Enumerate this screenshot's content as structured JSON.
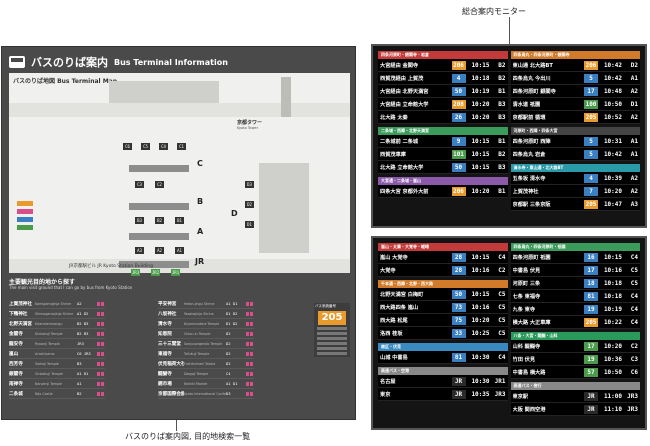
{
  "captions": {
    "monitor": "総合案内モニター",
    "board": "バスのりば案内図, 目的地検索一覧"
  },
  "board": {
    "title_jp": "バスのりば案内",
    "title_en": "Bus Terminal Information",
    "map_label": "バスのりば地図 Bus Terminal Map",
    "tower_jp": "京都タワー",
    "tower_en": "Kyoto Tower",
    "station_jp": "JR京都駅ビル",
    "station_en": "JR Kyoto Station Building",
    "zones": [
      "C",
      "B",
      "A",
      "D",
      "JR"
    ],
    "section_title": "主要観光目的地から探す",
    "section_sub": "The main visit ground that I can go by bus from Kyoto Station",
    "route_key_caption": "バス系統番号",
    "route_badge": "205"
  },
  "destinations": [
    [
      {
        "jp": "上賀茂神社",
        "en": "Kamigamojinja Shrine",
        "bays": "A2"
      },
      {
        "jp": "下鴨神社",
        "en": "Shimogamojinja Shrine",
        "bays": "A1 D2"
      },
      {
        "jp": "北野天満宮",
        "en": "Kitanotenmangu",
        "bays": "B2 B3"
      },
      {
        "jp": "金閣寺",
        "en": "Kinkakuji Temple",
        "bays": "B2 B3"
      },
      {
        "jp": "龍安寺",
        "en": "Ryoanji Temple",
        "bays": "JR3"
      },
      {
        "jp": "嵐山",
        "en": "Arashiyama",
        "bays": "C6 JR3"
      },
      {
        "jp": "西芳寺",
        "en": "Saihoji Temple",
        "bays": "B3"
      },
      {
        "jp": "銀閣寺",
        "en": "Ginkakuji Temple",
        "bays": "A1 D1"
      },
      {
        "jp": "南禅寺",
        "en": "Nanzenji Temple",
        "bays": "A1"
      },
      {
        "jp": "二条城",
        "en": "Nijo Castle",
        "bays": "B2"
      }
    ],
    [
      {
        "jp": "平安神宮",
        "en": "Heian-jingu Shrine",
        "bays": "A1 D1"
      },
      {
        "jp": "八坂神社",
        "en": "Yasakajinja Shrine",
        "bays": "D1 D2"
      },
      {
        "jp": "清水寺",
        "en": "Kiyomizudera Temple",
        "bays": "D1 D2"
      },
      {
        "jp": "知恩院",
        "en": "Chion-in Temple",
        "bays": "D2"
      },
      {
        "jp": "三十三間堂",
        "en": "Sanjusangendo Temple",
        "bays": "D2"
      },
      {
        "jp": "東福寺",
        "en": "Tofukuji Temple",
        "bays": "D2"
      },
      {
        "jp": "伏見稲荷大社",
        "en": "Fushimiinari Taisha",
        "bays": "D2"
      },
      {
        "jp": "醍醐寺",
        "en": "Daigoji Temple",
        "bays": "C4"
      },
      {
        "jp": "錦市場",
        "en": "Nishiki Market",
        "bays": "A1 D1"
      },
      {
        "jp": "京都国際会館",
        "en": "Kyoto International Conference",
        "bays": "D3"
      }
    ]
  ],
  "monitor1": {
    "left": [
      {
        "head": "四条河原町・銀閣寺・岩倉",
        "color": "#c23a3a",
        "rows": [
          {
            "dest": "大宮経由 金閣寺",
            "num": "206",
            "numColor": "#e89a2c",
            "time": "10:15",
            "bay": "B2"
          },
          {
            "dest": "西賀茂経由 上賀茂",
            "num": "4",
            "numColor": "#3a7fc2",
            "time": "10:18",
            "bay": "B2"
          },
          {
            "dest": "大宮経由 北野天満宮",
            "num": "50",
            "numColor": "#3a7fc2",
            "time": "10:19",
            "bay": "B1"
          },
          {
            "dest": "大宮経由 立命館大学",
            "num": "208",
            "numColor": "#e89a2c",
            "time": "10:20",
            "bay": "B3"
          },
          {
            "dest": "北大路 太秦",
            "num": "26",
            "numColor": "#3a7fc2",
            "time": "10:20",
            "bay": "B3"
          }
        ]
      },
      {
        "head": "二条城・西陣・北野天満宮",
        "color": "#3a9b5a",
        "rows": [
          {
            "dest": "二条城前 二条城",
            "num": "9",
            "numColor": "#3a7fc2",
            "time": "10:15",
            "bay": "B1"
          },
          {
            "dest": "西賀茂車庫",
            "num": "101",
            "numColor": "#4a9b4a",
            "time": "10:15",
            "bay": "B2"
          },
          {
            "dest": "北大路 立命館大学",
            "num": "50",
            "numColor": "#3a7fc2",
            "time": "10:15",
            "bay": "B3"
          }
        ]
      },
      {
        "head": "大宮通・二条城・嵐山",
        "color": "#8a5aa8",
        "rows": [
          {
            "dest": "四条大宮 京都外大前",
            "num": "206",
            "numColor": "#e89a2c",
            "time": "10:20",
            "bay": "B1"
          }
        ]
      }
    ],
    "right": [
      {
        "head": "四条烏丸・四条河原町・銀閣寺",
        "color": "#d07a2a",
        "rows": [
          {
            "dest": "東山通 北大路BT",
            "num": "206",
            "numColor": "#e89a2c",
            "time": "10:42",
            "bay": "D2"
          },
          {
            "dest": "四条烏丸 今出川",
            "num": "5",
            "numColor": "#3a7fc2",
            "time": "10:42",
            "bay": "A1"
          },
          {
            "dest": "四条河原町 銀閣寺",
            "num": "17",
            "numColor": "#3a7fc2",
            "time": "10:48",
            "bay": "A2"
          },
          {
            "dest": "清水道 祇園",
            "num": "100",
            "numColor": "#4a9b4a",
            "time": "10:50",
            "bay": "D1"
          },
          {
            "dest": "京都駅前 循環",
            "num": "205",
            "numColor": "#e89a2c",
            "time": "10:52",
            "bay": "A2"
          }
        ]
      },
      {
        "head": "河原町・西陣・四条大宮",
        "color": "#444444",
        "rows": [
          {
            "dest": "四条河原町 西陣",
            "num": "5",
            "numColor": "#3a7fc2",
            "time": "10:31",
            "bay": "A1"
          },
          {
            "dest": "四条烏丸 岩倉",
            "num": "5",
            "numColor": "#3a7fc2",
            "time": "10:42",
            "bay": "A1"
          }
        ]
      },
      {
        "head": "清水寺・東山通・北大路BT",
        "color": "#2a9aa8",
        "rows": [
          {
            "dest": "五条坂 清水寺",
            "num": "4",
            "numColor": "#3a7fc2",
            "time": "10:39",
            "bay": "A2"
          },
          {
            "dest": "上賀茂神社",
            "num": "7",
            "numColor": "#3a7fc2",
            "time": "10:20",
            "bay": "A2"
          },
          {
            "dest": "京都駅 三条京阪",
            "num": "205",
            "numColor": "#e89a2c",
            "time": "10:47",
            "bay": "A3"
          }
        ]
      }
    ]
  },
  "monitor2": {
    "left": [
      {
        "head": "嵐山・太秦・大覚寺・嵯峨",
        "color": "#c23a3a",
        "rows": [
          {
            "dest": "嵐山 大覚寺",
            "num": "28",
            "numColor": "#3a7fc2",
            "time": "10:15",
            "bay": "C4"
          },
          {
            "dest": "大覚寺",
            "num": "28",
            "numColor": "#3a7fc2",
            "time": "10:16",
            "bay": "C2"
          }
        ]
      },
      {
        "head": "千本通・西陣・北野・西大路",
        "color": "#d07a2a",
        "rows": [
          {
            "dest": "北野天満宮 白梅町",
            "num": "50",
            "numColor": "#3a7fc2",
            "time": "10:15",
            "bay": "C5"
          },
          {
            "dest": "西大路四条 嵐山",
            "num": "73",
            "numColor": "#3a7fc2",
            "time": "10:16",
            "bay": "C5"
          },
          {
            "dest": "西大路 松尾",
            "num": "75",
            "numColor": "#3a7fc2",
            "time": "10:20",
            "bay": "C5"
          },
          {
            "dest": "洛西 桂坂",
            "num": "33",
            "numColor": "#3a7fc2",
            "time": "10:25",
            "bay": "C5"
          }
        ]
      },
      {
        "head": "南区・伏見",
        "color": "#3a8ac2",
        "rows": [
          {
            "dest": "山城 中書島",
            "num": "81",
            "numColor": "#3a7fc2",
            "time": "10:30",
            "bay": "C4"
          }
        ]
      },
      {
        "head": "高速バス・空港",
        "color": "#888888",
        "rows": [
          {
            "dest": "名古屋",
            "num": "JR",
            "numColor": "#2a2a2a",
            "time": "10:30",
            "bay": "JR1"
          },
          {
            "dest": "東京",
            "num": "JR",
            "numColor": "#2a2a2a",
            "time": "10:35",
            "bay": "JR3"
          }
        ]
      }
    ],
    "right": [
      {
        "head": "四条烏丸・四条河原町・祇園",
        "color": "#3a9b5a",
        "rows": [
          {
            "dest": "四条河原町 祇園",
            "num": "16",
            "numColor": "#3a7fc2",
            "time": "10:15",
            "bay": "C4"
          },
          {
            "dest": "中書島 伏見",
            "num": "17",
            "numColor": "#3a7fc2",
            "time": "10:16",
            "bay": "C5"
          },
          {
            "dest": "河原町 三条",
            "num": "18",
            "numColor": "#3a7fc2",
            "time": "10:18",
            "bay": "C5"
          },
          {
            "dest": "七条 東福寺",
            "num": "81",
            "numColor": "#3a7fc2",
            "time": "10:18",
            "bay": "C4"
          },
          {
            "dest": "九条 東寺",
            "num": "19",
            "numColor": "#3a7fc2",
            "time": "10:19",
            "bay": "C4"
          },
          {
            "dest": "横大路 大正車庫",
            "num": "205",
            "numColor": "#e89a2c",
            "time": "10:22",
            "bay": "C4"
          }
        ]
      },
      {
        "head": "八条・大宮・醍醐・山科",
        "color": "#2a9a5a",
        "rows": [
          {
            "dest": "山科 醍醐寺",
            "num": "17",
            "numColor": "#4a9b4a",
            "time": "10:20",
            "bay": "C2"
          },
          {
            "dest": "竹田 伏見",
            "num": "19",
            "numColor": "#4a9b4a",
            "time": "10:36",
            "bay": "C3"
          },
          {
            "dest": "中書島 横大路",
            "num": "57",
            "numColor": "#4a9b4a",
            "time": "10:50",
            "bay": "C6"
          }
        ]
      },
      {
        "head": "高速バス・夜行",
        "color": "#888888",
        "rows": [
          {
            "dest": "東京駅",
            "num": "JR",
            "numColor": "#2a2a2a",
            "time": "11:00",
            "bay": "JR3"
          },
          {
            "dest": "大阪 関西空港",
            "num": "JR",
            "numColor": "#2a2a2a",
            "time": "11:10",
            "bay": "JR3"
          }
        ]
      }
    ]
  }
}
